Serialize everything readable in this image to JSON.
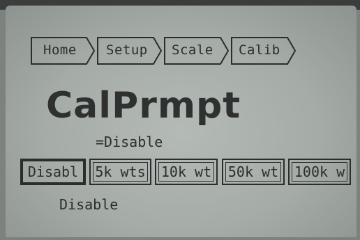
{
  "breadcrumb": {
    "items": [
      {
        "label": "Home"
      },
      {
        "label": "Setup"
      },
      {
        "label": "Scale"
      },
      {
        "label": "Calib"
      }
    ]
  },
  "screen": {
    "title": "CalPrmpt",
    "current_value": "=Disable",
    "options": [
      {
        "label": "Disabl",
        "selected": true
      },
      {
        "label": "5k wts",
        "selected": false
      },
      {
        "label": "10k wt",
        "selected": false
      },
      {
        "label": "50k wt",
        "selected": false
      },
      {
        "label": "100k w",
        "selected": false
      }
    ],
    "description": "Disable"
  },
  "colors": {
    "lcd_background": "#a9b0ab",
    "lcd_foreground": "#2b2d2c",
    "bezel": "#3a3d3b"
  }
}
